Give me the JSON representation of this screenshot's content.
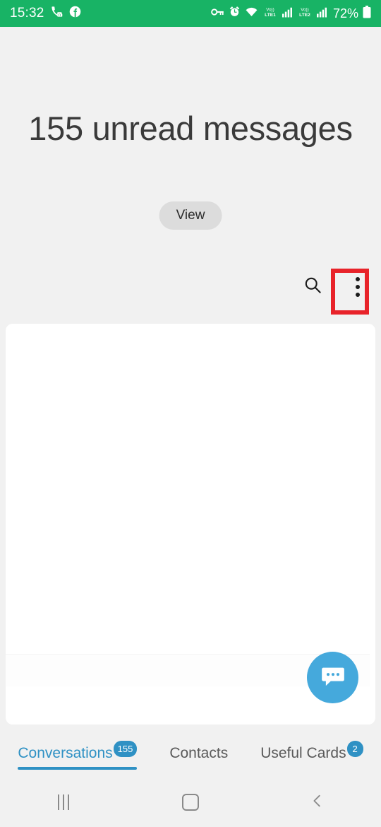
{
  "status_bar": {
    "time": "15:32",
    "battery_percent": "72%",
    "left_icons": [
      "missed-call-icon",
      "facebook-icon"
    ],
    "right_icons": [
      "vpn-key-icon",
      "alarm-icon",
      "wifi-icon",
      "volte-lte1-icon",
      "signal-bars-1-icon",
      "volte-lte2-icon",
      "signal-bars-2-icon",
      "battery-icon"
    ],
    "background_color": "#18b365",
    "lte1_label": "LTE1",
    "lte2_label": "LTE2",
    "volte_label": "VoLTE"
  },
  "hero": {
    "title": "155 unread messages",
    "view_label": "View"
  },
  "actions": {
    "search_icon": "search-icon",
    "overflow_icon": "more-vertical-icon"
  },
  "annotation": {
    "color": "#e8232a",
    "highlight_target": "overflow-menu-button",
    "arrow_direction": "up"
  },
  "fab": {
    "icon": "chat-bubble-icon",
    "color": "#45a9dc"
  },
  "tabs": [
    {
      "label": "Conversations",
      "badge": "155",
      "active": true
    },
    {
      "label": "Contacts",
      "badge": "",
      "active": false
    },
    {
      "label": "Useful Cards",
      "badge": "2",
      "active": false
    }
  ],
  "nav_bar": {
    "recents_label": "recents-icon",
    "home_label": "home-icon",
    "back_label": "back-icon"
  },
  "theme": {
    "accent": "#2f91c4",
    "background": "#f1f1f1",
    "card": "#ffffff"
  }
}
